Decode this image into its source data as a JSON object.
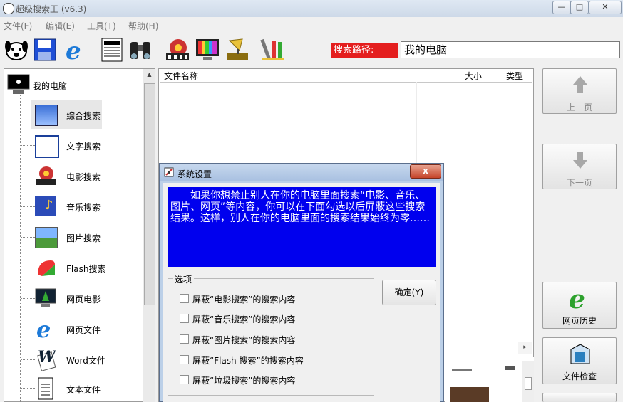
{
  "window": {
    "title": "超级搜索王 (v6.3)",
    "minimize": "—",
    "maximize": "□",
    "close": "✕"
  },
  "menu": [
    "文件(F)",
    "编辑(E)",
    "工具(T)",
    "帮助(H)"
  ],
  "toolbar": {
    "icons": [
      "dog-icon",
      "save-icon",
      "ie-icon",
      "document-icon",
      "binoculars-icon",
      "film-icon",
      "monitor-icon",
      "gramophone-icon",
      "tools-icon"
    ],
    "path_label": "搜索路径:",
    "path_value": "我的电脑"
  },
  "tree": {
    "root": "我的电脑",
    "items": [
      {
        "label": "综合搜索",
        "icon": "combined-search-icon"
      },
      {
        "label": "文字搜索",
        "icon": "text-search-icon"
      },
      {
        "label": "电影搜索",
        "icon": "movie-search-icon"
      },
      {
        "label": "音乐搜索",
        "icon": "music-search-icon"
      },
      {
        "label": "图片搜索",
        "icon": "picture-search-icon"
      },
      {
        "label": "Flash搜索",
        "icon": "flash-search-icon"
      },
      {
        "label": "网页电影",
        "icon": "web-movie-icon"
      },
      {
        "label": "网页文件",
        "icon": "web-file-icon"
      },
      {
        "label": "Word文件",
        "icon": "word-file-icon"
      },
      {
        "label": "文本文件",
        "icon": "text-file-icon"
      }
    ]
  },
  "file_list": {
    "columns": [
      "文件名称",
      "大小",
      "类型"
    ]
  },
  "right_buttons": {
    "prev": "上一页",
    "next": "下一页",
    "history": "网页历史",
    "check": "文件检查"
  },
  "dialog": {
    "title": "系统设置",
    "close": "x",
    "notice": "如果你想禁止别人在你的电脑里面搜索“电影、音乐、图片、网页”等内容，你可以在下面勾选以后屏蔽这些搜索结果。这样，别人在你的电脑里面的搜索结果始终为零……",
    "group_label": "选项",
    "options": [
      "屏蔽“电影搜索”的搜索内容",
      "屏蔽“音乐搜索”的搜索内容",
      "屏蔽“图片搜索”的搜索内容",
      "屏蔽“Flash 搜索”的搜索内容",
      "屏蔽“垃圾搜索”的搜索内容"
    ],
    "ok": "确定(Y)"
  }
}
